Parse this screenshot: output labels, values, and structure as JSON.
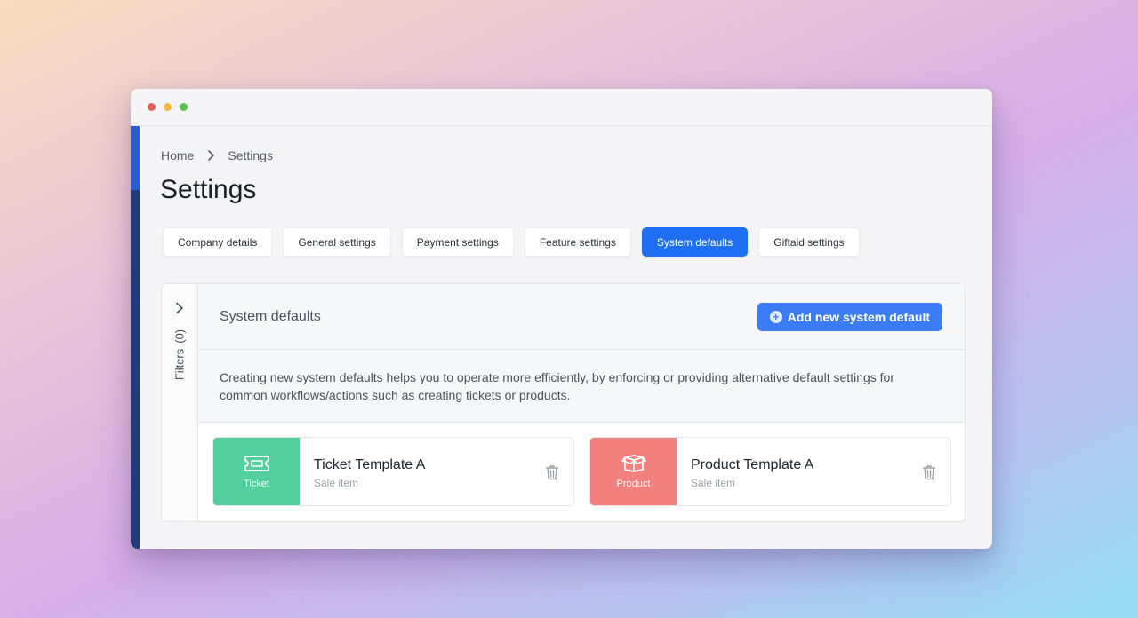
{
  "window": {
    "controls": [
      "close",
      "minimize",
      "maximize"
    ]
  },
  "breadcrumb": {
    "home": "Home",
    "current": "Settings"
  },
  "page": {
    "title": "Settings"
  },
  "tabs": [
    {
      "label": "Company details",
      "active": false
    },
    {
      "label": "General settings",
      "active": false
    },
    {
      "label": "Payment settings",
      "active": false
    },
    {
      "label": "Feature settings",
      "active": false
    },
    {
      "label": "System defaults",
      "active": true
    },
    {
      "label": "Giftaid settings",
      "active": false
    }
  ],
  "filters": {
    "label": "Filters",
    "count": "(0)"
  },
  "section": {
    "title": "System defaults",
    "add_button": "Add new system default",
    "description": "Creating new system defaults helps you to operate more efficiently, by enforcing or providing alternative default settings for common workflows/actions such as creating tickets or products."
  },
  "cards": [
    {
      "badge": "Ticket",
      "badge_color": "#52cf9c",
      "icon": "ticket-icon",
      "title": "Ticket Template A",
      "subtitle": "Sale item"
    },
    {
      "badge": "Product",
      "badge_color": "#f2807d",
      "icon": "box-icon",
      "title": "Product Template A",
      "subtitle": "Sale item"
    }
  ],
  "colors": {
    "accent": "#1f6ff2",
    "button": "#3b7cf4",
    "sidebar": "#203a7a"
  }
}
